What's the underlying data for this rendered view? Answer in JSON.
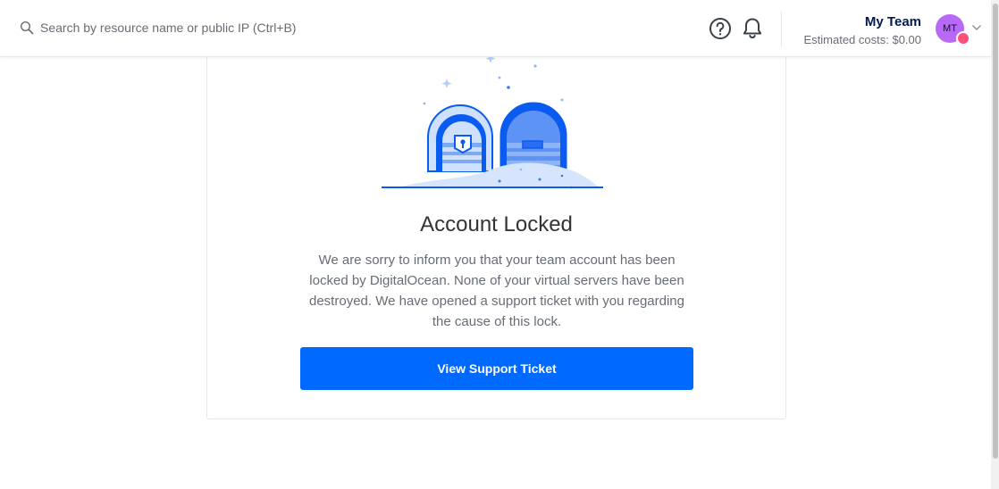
{
  "topbar": {
    "search": {
      "placeholder": "Search by resource name or public IP (Ctrl+B)",
      "icon": "search-icon"
    },
    "help_icon": "help-circle-icon",
    "notifications_icon": "bell-icon",
    "team": {
      "name": "My Team",
      "estimated_costs": "Estimated costs: $0.00"
    },
    "avatar": {
      "initials": "MT",
      "color": "#b969f8",
      "badge_color": "#ff4f7b"
    },
    "menu_icon": "chevron-down-icon"
  },
  "main": {
    "illustration": "treasure-chest-locked-illustration",
    "title": "Account Locked",
    "message": "We are sorry to inform you that your team account has been locked by DigitalOcean. None of your virtual servers have been destroyed. We have opened a support ticket with you regarding the cause of this lock.",
    "primary_button": "View Support Ticket"
  },
  "colors": {
    "accent": "#0069ff",
    "text_dark": "#031b4e",
    "text_muted": "#676c75"
  }
}
